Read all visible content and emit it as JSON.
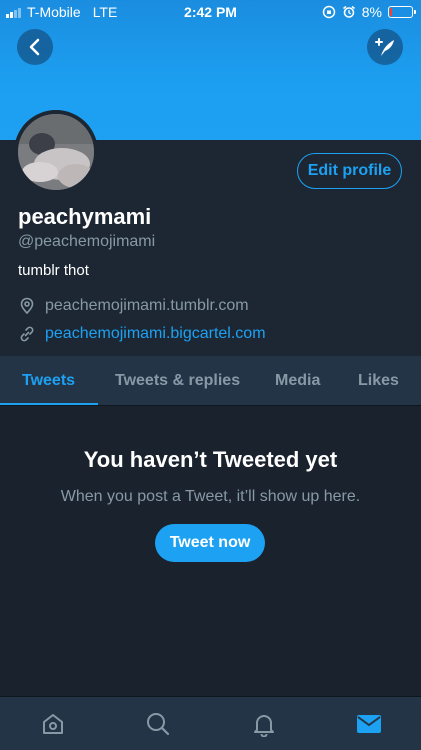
{
  "status_bar": {
    "carrier": "T-Mobile",
    "network": "LTE",
    "time": "2:42 PM",
    "battery": "8%",
    "battery_level": 0.08,
    "battery_color": "#ff3b30"
  },
  "nav": {
    "back_icon": "chevron-left-icon",
    "compose_icon": "compose-feather-icon"
  },
  "profile": {
    "display_name": "peachymami",
    "handle": "@peachemojimami",
    "bio": "tumblr thot",
    "location": "peachemojimami.tumblr.com",
    "website": "peachemojimami.bigcartel.com",
    "edit_profile_label": "Edit profile"
  },
  "tabs": [
    {
      "label": "Tweets",
      "active": true
    },
    {
      "label": "Tweets & replies",
      "active": false
    },
    {
      "label": "Media",
      "active": false
    },
    {
      "label": "Likes",
      "active": false
    }
  ],
  "empty_state": {
    "title": "You haven’t Tweeted yet",
    "subtitle": "When you post a Tweet, it’ll show up here.",
    "button_label": "Tweet now"
  },
  "tabbar": {
    "items": [
      "home-icon",
      "search-icon",
      "notifications-bell-icon",
      "messages-envelope-icon"
    ],
    "active": "messages-envelope-icon"
  },
  "colors": {
    "accent": "#1da1f2",
    "background": "#1c2733",
    "secondary_text": "#8899a6"
  }
}
